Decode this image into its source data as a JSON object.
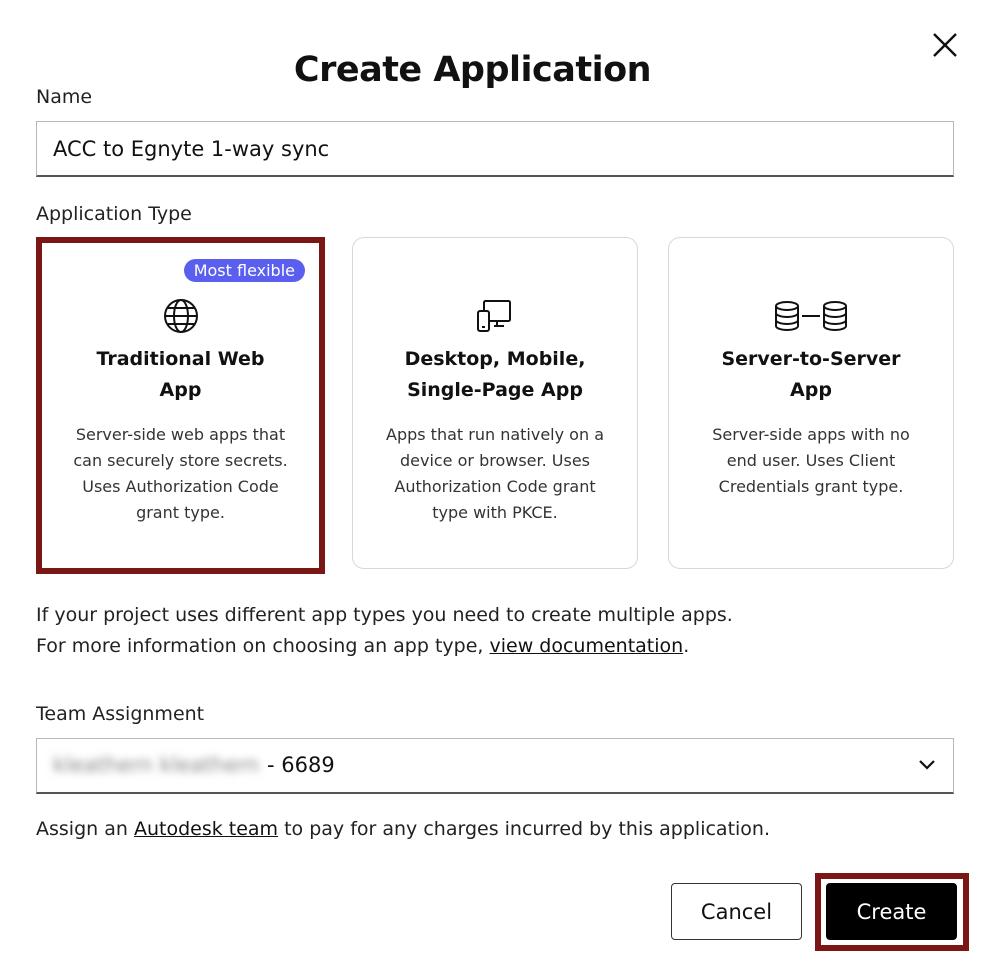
{
  "dialog": {
    "title": "Create Application",
    "close_icon": "close-icon"
  },
  "name_field": {
    "label": "Name",
    "value": "ACC to Egnyte 1-way sync"
  },
  "app_type": {
    "label": "Application Type",
    "cards": [
      {
        "title_line1": "Traditional Web",
        "title_line2": "App",
        "badge": "Most flexible",
        "icon": "globe-icon",
        "desc": [
          "Server-side web apps that",
          "can securely store secrets.",
          "Uses Authorization Code",
          "grant type."
        ],
        "selected": true
      },
      {
        "title_line1": "Desktop, Mobile,",
        "title_line2": "Single-Page App",
        "icon": "devices-icon",
        "desc": [
          "Apps that run natively on a",
          "device or browser. Uses",
          "Authorization Code grant",
          "type with PKCE."
        ],
        "selected": false
      },
      {
        "title_line1": "Server-to-Server",
        "title_line2": "App",
        "icon": "database-link-icon",
        "desc": [
          "Server-side apps with no",
          "end user. Uses Client",
          "Credentials grant type."
        ],
        "selected": false
      }
    ]
  },
  "info": {
    "line1": "If your project uses different app types you need to create multiple apps.",
    "line2_prefix": "For more information on choosing an app type, ",
    "line2_link": "view documentation",
    "line2_suffix": "."
  },
  "team": {
    "label": "Team Assignment",
    "blurred_name": "kleathern kleathern",
    "suffix": "- 6689",
    "chevron_icon": "chevron-down-icon"
  },
  "assign": {
    "prefix": "Assign an ",
    "link": "Autodesk team",
    "suffix": " to pay for any charges incurred by this application."
  },
  "buttons": {
    "cancel": "Cancel",
    "create": "Create"
  },
  "colors": {
    "highlight": "#7a1614",
    "badge": "#5b5fef",
    "primary": "#000000"
  }
}
